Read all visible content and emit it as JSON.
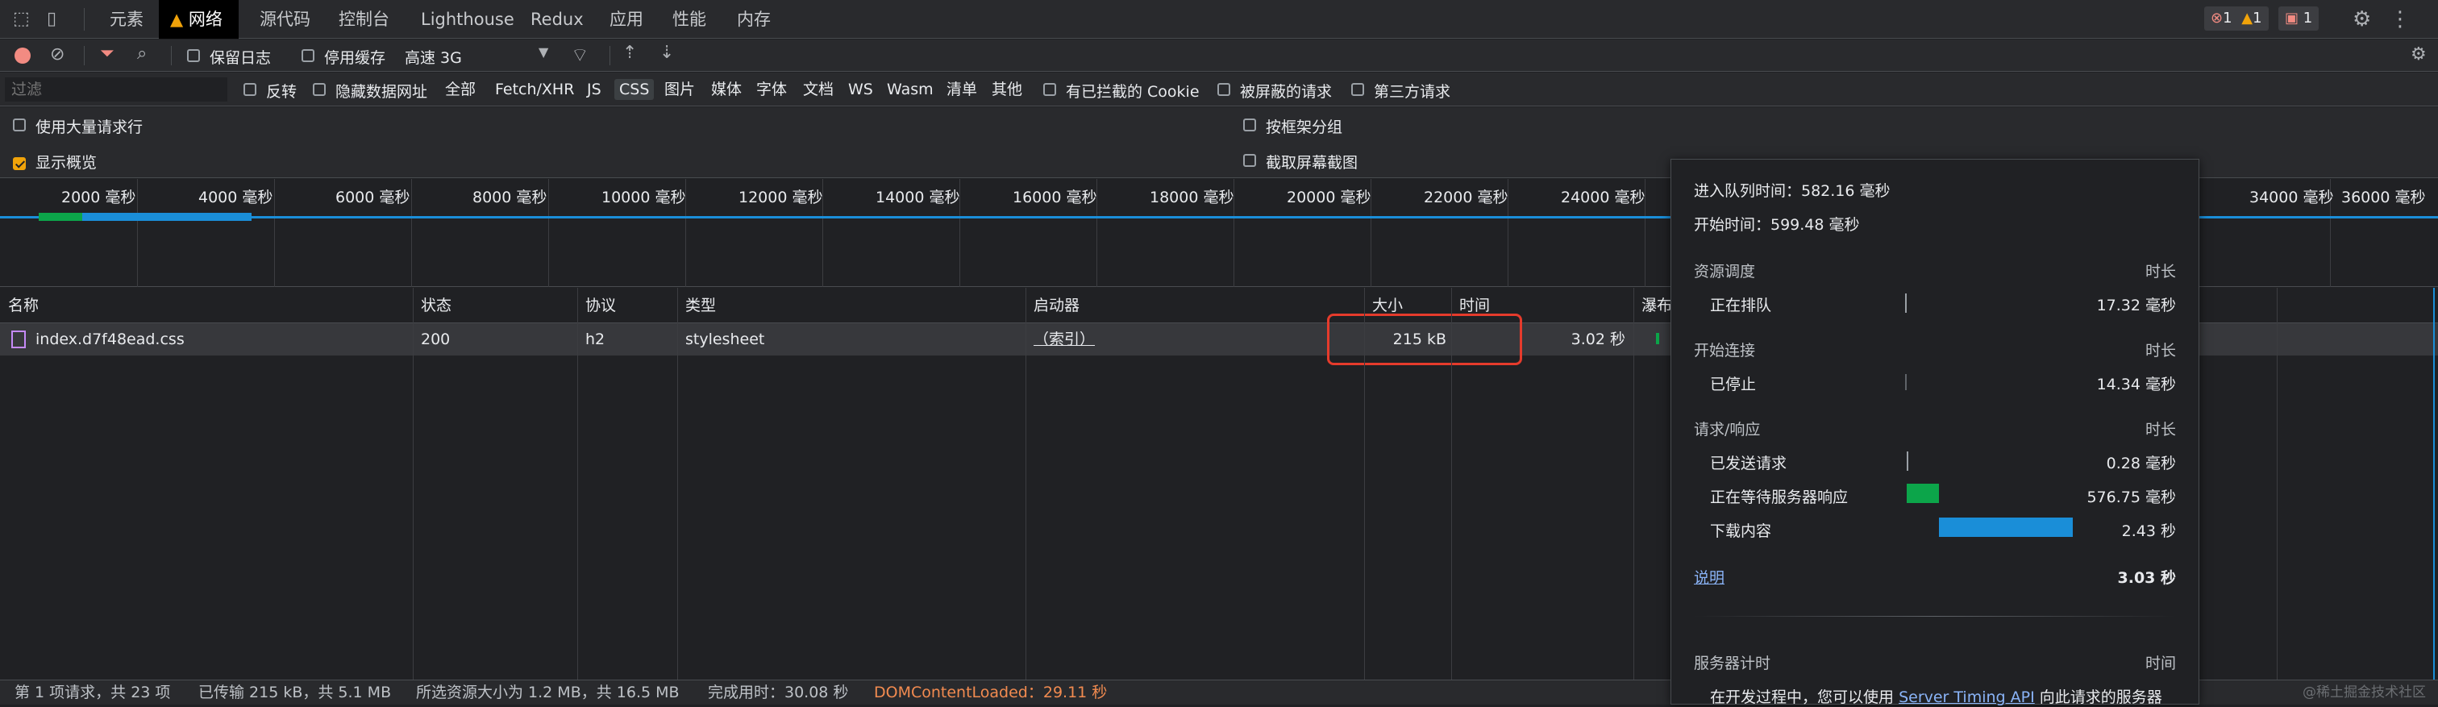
{
  "top_tabs": [
    "元素",
    "网络",
    "源代码",
    "控制台",
    "Lighthouse",
    "Redux",
    "应用",
    "性能",
    "内存"
  ],
  "active_tab": "网络",
  "badges": {
    "errors": "1",
    "warnings": "1",
    "issues": "1"
  },
  "toolbar": {
    "preserve_log": "保留日志",
    "disable_cache": "停用缓存",
    "throttling": "高速 3G"
  },
  "filter": {
    "placeholder": "过滤",
    "invert": "反转",
    "hide_data_urls": "隐藏数据网址",
    "types": [
      "全部",
      "Fetch/XHR",
      "JS",
      "CSS",
      "图片",
      "媒体",
      "字体",
      "文档",
      "WS",
      "Wasm",
      "清单",
      "其他"
    ],
    "active_type": "CSS",
    "blocked_cookies": "有已拦截的 Cookie",
    "blocked_requests": "被屏蔽的请求",
    "third_party": "第三方请求"
  },
  "options": {
    "large_rows": "使用大量请求行",
    "group_by_frame": "按框架分组",
    "show_overview": "显示概览",
    "capture_screenshots": "截取屏幕截图"
  },
  "overview_ticks": [
    "2000 毫秒",
    "4000 毫秒",
    "6000 毫秒",
    "8000 毫秒",
    "10000 毫秒",
    "12000 毫秒",
    "14000 毫秒",
    "16000 毫秒",
    "18000 毫秒",
    "20000 毫秒",
    "22000 毫秒",
    "24000 毫秒",
    "34000 毫秒",
    "36000 毫秒"
  ],
  "table": {
    "headers": {
      "name": "名称",
      "status": "状态",
      "protocol": "协议",
      "type": "类型",
      "initiator": "启动器",
      "size": "大小",
      "time": "时间",
      "waterfall": "瀑布"
    },
    "rows": [
      {
        "name": "index.d7f48ead.css",
        "status": "200",
        "protocol": "h2",
        "type": "stylesheet",
        "initiator": "（索引）",
        "size": "215 kB",
        "time": "3.02 秒"
      }
    ]
  },
  "statusbar": {
    "requests": "第 1 项请求，共 23 项",
    "transferred": "已传输 215 kB，共 5.1 MB",
    "resources": "所选资源大小为 1.2 MB，共 16.5 MB",
    "finish": "完成用时：30.08 秒",
    "dcl": "DOMContentLoaded：29.11 秒"
  },
  "tooltip": {
    "queued": "进入队列时间：582.16 毫秒",
    "started": "开始时间：599.48 毫秒",
    "duration_label": "时长",
    "sections": [
      {
        "title": "资源调度",
        "items": [
          {
            "label": "正在排队",
            "value": "17.32 毫秒",
            "fraction": 0.006
          }
        ]
      },
      {
        "title": "开始连接",
        "items": [
          {
            "label": "已停止",
            "value": "14.34 毫秒",
            "fraction": 0.005
          }
        ]
      },
      {
        "title": "请求/响应",
        "items": [
          {
            "label": "已发送请求",
            "value": "0.28 毫秒",
            "fraction": 0.001
          },
          {
            "label": "正在等待服务器响应",
            "value": "576.75 毫秒",
            "fraction": 0.19
          },
          {
            "label": "下载内容",
            "value": "2.43 秒",
            "fraction": 0.8
          }
        ]
      }
    ],
    "explanation": "说明",
    "total": "3.03 秒",
    "server_timing_title": "服务器计时",
    "server_timing_time": "时间",
    "server_timing_text": "在开发过程中，您可以使用",
    "server_timing_link": "Server Timing API",
    "server_timing_text2": "向此请求的服务器"
  },
  "watermark": "@稀土掘金技术社区",
  "colors": {
    "accent": "#8ab4f8",
    "waiting": "#0ca54a",
    "download": "#1a8ed8",
    "highlight_box": "#e53b2c",
    "dcl": "#f28b50",
    "warning": "#f0a30a",
    "error": "#f28b82"
  }
}
